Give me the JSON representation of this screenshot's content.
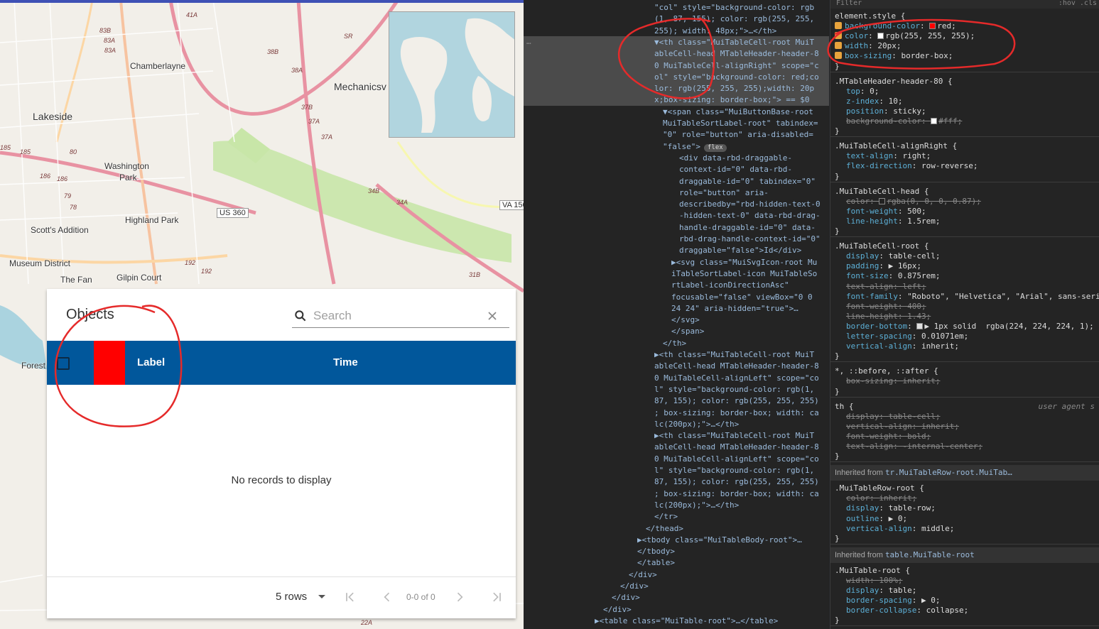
{
  "map": {
    "places": [
      "Chamberlayne",
      "Lakeside",
      "Mechanicsv",
      "Washington",
      "Park",
      "Highland Park",
      "Scott's Addition",
      "Museum District",
      "The Fan",
      "Gilpin Court",
      "Forest"
    ],
    "route_labels": [
      "83B",
      "83A",
      "83A",
      "41A",
      "38B",
      "38A",
      "37B",
      "37A",
      "37A",
      "34B",
      "34A",
      "31B",
      "186",
      "186",
      "185",
      "185",
      "80",
      "79",
      "78",
      "192",
      "192",
      "SR",
      "22A"
    ],
    "us_shields": [
      "US 360",
      "VA 156"
    ]
  },
  "table": {
    "title": "Objects",
    "search_placeholder": "Search",
    "columns": [
      "Label",
      "Time"
    ],
    "empty_message": "No records to display",
    "rows_per_page": "5 rows",
    "page_info": "0-0 of 0"
  },
  "devtools": {
    "elements": {
      "lines": [
        {
          "indent": 184,
          "html": "\"col\" style=\"background-color: rgb"
        },
        {
          "indent": 184,
          "html": "(1, 87, 155); color: rgb(255, 255,"
        },
        {
          "indent": 184,
          "html": "255); width: 48px;\">…</th>"
        },
        {
          "indent": 184,
          "html": "▼<th class=\"MuiTableCell-root MuiT"
        },
        {
          "indent": 184,
          "html": "ableCell-head MTableHeader-header-8"
        },
        {
          "indent": 184,
          "html": "0 MuiTableCell-alignRight\" scope=\"c"
        },
        {
          "indent": 184,
          "html": "ol\" style=\"background-color: red;co"
        },
        {
          "indent": 184,
          "html": "lor: rgb(255, 255, 255);width: 20p"
        },
        {
          "indent": 184,
          "html": "x;box-sizing: border-box;\"> == $0"
        },
        {
          "indent": 196,
          "html": "▼<span class=\"MuiButtonBase-root"
        },
        {
          "indent": 196,
          "html": "MuiTableSortLabel-root\" tabindex="
        },
        {
          "indent": 196,
          "html": "\"0\" role=\"button\" aria-disabled="
        },
        {
          "indent": 196,
          "html": "\"false\">"
        },
        {
          "indent": 219,
          "html": "<div data-rbd-draggable-"
        },
        {
          "indent": 219,
          "html": "context-id=\"0\" data-rbd-"
        },
        {
          "indent": 219,
          "html": "draggable-id=\"0\" tabindex=\"0\""
        },
        {
          "indent": 219,
          "html": "role=\"button\" aria-"
        },
        {
          "indent": 219,
          "html": "describedby=\"rbd-hidden-text-0"
        },
        {
          "indent": 219,
          "html": "-hidden-text-0\" data-rbd-drag-"
        },
        {
          "indent": 219,
          "html": "handle-draggable-id=\"0\" data-"
        },
        {
          "indent": 219,
          "html": "rbd-drag-handle-context-id=\"0\""
        },
        {
          "indent": 219,
          "html": "draggable=\"false\">Id</div>"
        },
        {
          "indent": 208,
          "html": "▶<svg class=\"MuiSvgIcon-root Mu"
        },
        {
          "indent": 208,
          "html": "iTableSortLabel-icon MuiTableSo"
        },
        {
          "indent": 208,
          "html": "rtLabel-iconDirectionAsc\""
        },
        {
          "indent": 208,
          "html": "focusable=\"false\" viewBox=\"0 0"
        },
        {
          "indent": 208,
          "html": "24 24\" aria-hidden=\"true\">…"
        },
        {
          "indent": 208,
          "html": "</svg>"
        },
        {
          "indent": 208,
          "html": "</span>"
        },
        {
          "indent": 196,
          "html": "</th>"
        },
        {
          "indent": 184,
          "html": "▶<th class=\"MuiTableCell-root MuiT"
        },
        {
          "indent": 184,
          "html": "ableCell-head MTableHeader-header-8"
        },
        {
          "indent": 184,
          "html": "0 MuiTableCell-alignLeft\" scope=\"co"
        },
        {
          "indent": 184,
          "html": "l\" style=\"background-color: rgb(1,"
        },
        {
          "indent": 184,
          "html": "87, 155); color: rgb(255, 255, 255)"
        },
        {
          "indent": 184,
          "html": "; box-sizing: border-box; width: ca"
        },
        {
          "indent": 184,
          "html": "lc(200px);\">…</th>"
        },
        {
          "indent": 184,
          "html": "▶<th class=\"MuiTableCell-root MuiT"
        },
        {
          "indent": 184,
          "html": "ableCell-head MTableHeader-header-8"
        },
        {
          "indent": 184,
          "html": "0 MuiTableCell-alignLeft\" scope=\"co"
        },
        {
          "indent": 184,
          "html": "l\" style=\"background-color: rgb(1,"
        },
        {
          "indent": 184,
          "html": "87, 155); color: rgb(255, 255, 255)"
        },
        {
          "indent": 184,
          "html": "; box-sizing: border-box; width: ca"
        },
        {
          "indent": 184,
          "html": "lc(200px);\">…</th>"
        },
        {
          "indent": 184,
          "html": "</tr>"
        },
        {
          "indent": 172,
          "html": "</thead>"
        },
        {
          "indent": 160,
          "html": "▶<tbody class=\"MuiTableBody-root\">…"
        },
        {
          "indent": 160,
          "html": "</tbody>"
        },
        {
          "indent": 160,
          "html": "</table>"
        },
        {
          "indent": 148,
          "html": "</div>"
        },
        {
          "indent": 136,
          "html": "</div>"
        },
        {
          "indent": 124,
          "html": "</div>"
        },
        {
          "indent": 112,
          "html": "</div>"
        },
        {
          "indent": 100,
          "html": "▶<table class=\"MuiTable-root\">…</table>"
        }
      ],
      "ellipsis": "…",
      "flex_badge": "flex"
    },
    "styles": {
      "filter_placeholder": "Filter",
      "hov_cls": ":hov  .cls",
      "rules": [
        {
          "selector": "element.style {",
          "props": [
            {
              "p": "background-color",
              "v": "red;",
              "checked": true,
              "swatch": "#ff0000"
            },
            {
              "p": "color",
              "v": "rgb(255, 255, 255);",
              "checked": true,
              "swatch": "#ffffff"
            },
            {
              "p": "width",
              "v": "20px;",
              "checked": true
            },
            {
              "p": "box-sizing",
              "v": "border-box;",
              "checked": true
            }
          ]
        },
        {
          "selector": ".MTableHeader-header-80 {",
          "props": [
            {
              "p": "top",
              "v": "0;"
            },
            {
              "p": "z-index",
              "v": "10;"
            },
            {
              "p": "position",
              "v": "sticky;"
            },
            {
              "p": "background-color",
              "v": "#fff;",
              "struck": true,
              "swatch": "#ffffff"
            }
          ]
        },
        {
          "selector": ".MuiTableCell-alignRight {",
          "props": [
            {
              "p": "text-align",
              "v": "right;"
            },
            {
              "p": "flex-direction",
              "v": "row-reverse;"
            }
          ]
        },
        {
          "selector": ".MuiTableCell-head {",
          "props": [
            {
              "p": "color",
              "v": "rgba(0, 0, 0, 0.87);",
              "struck": true,
              "swatch": "#222222"
            },
            {
              "p": "font-weight",
              "v": "500;"
            },
            {
              "p": "line-height",
              "v": "1.5rem;"
            }
          ]
        },
        {
          "selector": ".MuiTableCell-root {",
          "props": [
            {
              "p": "display",
              "v": "table-cell;"
            },
            {
              "p": "padding",
              "v": "▶ 16px;"
            },
            {
              "p": "font-size",
              "v": "0.875rem;"
            },
            {
              "p": "text-align",
              "v": "left;",
              "struck": true
            },
            {
              "p": "font-family",
              "v": "\"Roboto\", \"Helvetica\", \"Arial\", sans-seri"
            },
            {
              "p": "font-weight",
              "v": "400;",
              "struck": true
            },
            {
              "p": "line-height",
              "v": "1.43;",
              "struck": true
            },
            {
              "p": "border-bottom",
              "v": "▶ 1px solid  rgba(224, 224, 224, 1);",
              "swatch": "#e0e0e0"
            },
            {
              "p": "letter-spacing",
              "v": "0.01071em;"
            },
            {
              "p": "vertical-align",
              "v": "inherit;"
            }
          ]
        },
        {
          "selector": "*, ::before, ::after {",
          "props": [
            {
              "p": "box-sizing",
              "v": "inherit;",
              "struck": true
            }
          ]
        },
        {
          "selector": "th {",
          "ua": "user agent s",
          "props": [
            {
              "p": "display",
              "v": "table-cell;",
              "struck": true
            },
            {
              "p": "vertical-align",
              "v": "inherit;",
              "struck": true
            },
            {
              "p": "font-weight",
              "v": "bold;",
              "struck": true
            },
            {
              "p": "text-align",
              "v": "-internal-center;",
              "struck": true
            }
          ]
        }
      ],
      "inherited_1_label": "Inherited from",
      "inherited_1_link": "tr.MuiTableRow-root.MuiTab…",
      "rule_tablerow": {
        "selector": ".MuiTableRow-root {",
        "props": [
          {
            "p": "color",
            "v": "inherit;",
            "struck": true
          },
          {
            "p": "display",
            "v": "table-row;"
          },
          {
            "p": "outline",
            "v": "▶ 0;"
          },
          {
            "p": "vertical-align",
            "v": "middle;"
          }
        ]
      },
      "inherited_2_label": "Inherited from",
      "inherited_2_link": "table.MuiTable-root",
      "rule_table": {
        "selector": ".MuiTable-root {",
        "props": [
          {
            "p": "width",
            "v": "100%;",
            "struck": true
          },
          {
            "p": "display",
            "v": "table;"
          },
          {
            "p": "border-spacing",
            "v": "▶ 0;"
          },
          {
            "p": "border-collapse",
            "v": "collapse;"
          }
        ]
      }
    }
  },
  "colors": {
    "header_blue": "#01579b",
    "annotation_red": "#e52a2a",
    "highlight_cell": "#ff0000"
  }
}
